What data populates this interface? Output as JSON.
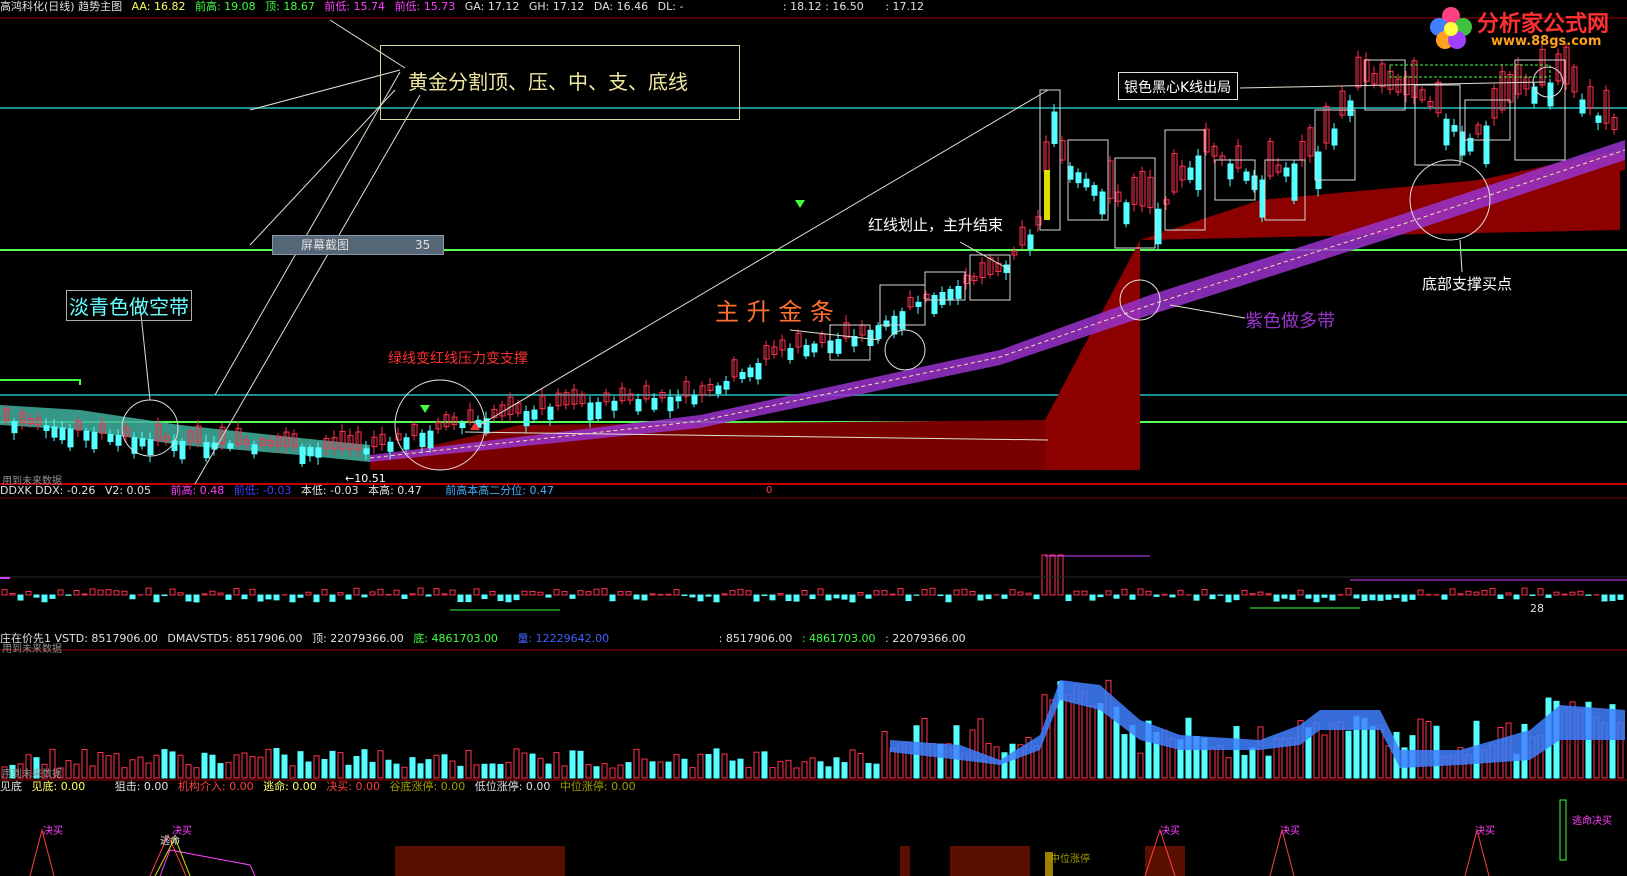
{
  "header_main": {
    "title": "高鸿科化(日线) 趋势主图",
    "items": [
      "AA: 16.82",
      "前高: 19.08",
      "顶: 18.67",
      "前低: 15.74",
      "前低: 15.73",
      "GA: 17.12",
      "GH: 17.12",
      "DA: 16.46",
      "DL: -",
      ": 18.12 : 16.50",
      ": 17.12"
    ]
  },
  "header_ind1": {
    "items": [
      "DDXK DDX: -0.26",
      "V2: 0.05",
      "前高: 0.48",
      "前低: -0.03",
      "本低: -0.03",
      "本高: 0.47",
      "前高本高二分位: 0.47"
    ]
  },
  "header_ind2": {
    "items": [
      "庄在价先1 VSTD: 8517906.00",
      "DMAVSTD5: 8517906.00",
      "顶: 22079366.00",
      "底: 4861703.00",
      "量: 12229642.00",
      ": 8517906.00",
      ": 4861703.00",
      ": 22079366.00"
    ]
  },
  "header_ind3": {
    "items": [
      "见底",
      "见底: 0.00",
      "狙击: 0.00",
      "机构介入: 0.00",
      "逃命: 0.00",
      "决买: 0.00",
      "谷底涨停: 0.00",
      "低位涨停: 0.00",
      "中位涨停: 0.00"
    ]
  },
  "annotations": {
    "golden": "黄金分割顶、压、中、支、底线",
    "screenshot_label": "屏幕截图",
    "screenshot_value": "35",
    "cyan_band": "淡青色做空带",
    "green_to_red": "绿线变红线压力变支撑",
    "main_rise": "主 升 金 条",
    "red_line": "红线划止，主升结束",
    "silver": "银色黑心K线出局",
    "purple_band": "紫色做多带",
    "bottom_support": "底部支撑买点",
    "low_price": "←10.51",
    "no_data1": "用到未来数据",
    "no_data2": "用到未来数据",
    "no_data3": "用到未来数据",
    "ind1_val": "28",
    "ind3_mid": "中位涨停",
    "escape": "逃命",
    "buy1": "决买",
    "buy2": "决买",
    "buy3": "决买",
    "buy4": "决买",
    "buy5": "决买",
    "buy6": "决买",
    "escape_buy": "逃命决买",
    "zero_marker": "0"
  },
  "logo": {
    "text": "分析家公式网",
    "url_text": "www.88gs.com"
  },
  "colors": {
    "up": "#ff3050",
    "down": "#55ffff",
    "teal_line": "#1a8a8a",
    "green_line": "#40ff40",
    "red_area": "#8c0000",
    "purple": "#9933cc",
    "golden_text": "#f0e8a0"
  }
}
